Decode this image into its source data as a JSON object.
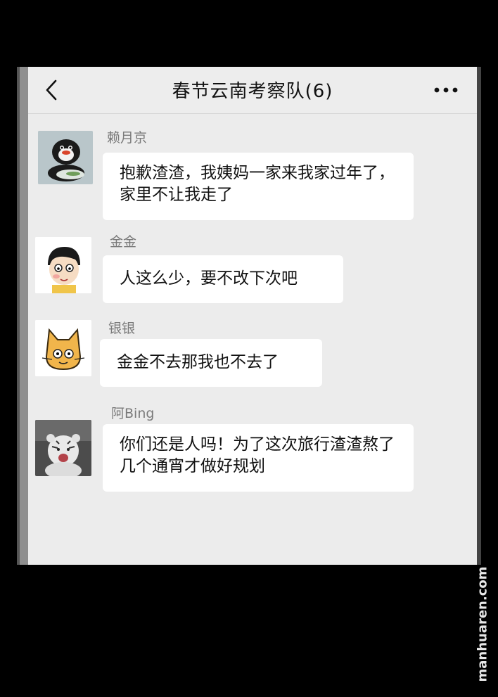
{
  "header": {
    "back_icon": "chevron-left-icon",
    "title": "春节云南考察队(6)",
    "more_icon": "more-dots-icon"
  },
  "messages": [
    {
      "sender": "赖月京",
      "avatar": "penguin-avatar",
      "text": "抱歉渣渣，我姨妈一家来我家过年了，家里不让我走了"
    },
    {
      "sender": "金金",
      "avatar": "cartoon-boy-avatar",
      "text": "人这么少，要不改下次吧"
    },
    {
      "sender": "银银",
      "avatar": "cat-avatar",
      "text": "金金不去那我也不去了"
    },
    {
      "sender": "阿Bing",
      "avatar": "white-tiger-avatar",
      "text": "你们还是人吗！为了这次旅行渣渣熬了几个通宵才做好规划"
    }
  ],
  "watermark": "manhuaren.com"
}
